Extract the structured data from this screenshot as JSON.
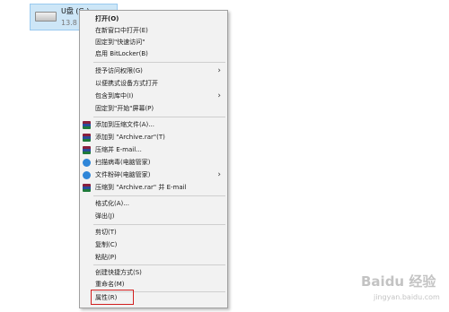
{
  "drive": {
    "name": "U盘 (G:)",
    "size": "13.8",
    "icon": "usb-drive-icon"
  },
  "menu": {
    "items": [
      {
        "label": "打开(O)",
        "bold": true
      },
      {
        "label": "在新窗口中打开(E)"
      },
      {
        "label": "固定到\"快速访问\""
      },
      {
        "label": "启用 BitLocker(B)"
      },
      {
        "label": "授予访问权限(G)",
        "submenu": true
      },
      {
        "label": "以便携式设备方式打开"
      },
      {
        "label": "包含到库中(I)",
        "submenu": true
      },
      {
        "label": "固定到\"开始\"屏幕(P)"
      },
      {
        "label": "添加到压缩文件(A)...",
        "icon": "winrar-icon"
      },
      {
        "label": "添加到 \"Archive.rar\"(T)",
        "icon": "winrar-icon"
      },
      {
        "label": "压缩并 E-mail...",
        "icon": "winrar-icon"
      },
      {
        "label": "扫描病毒(电脑管家)",
        "icon": "shield-icon"
      },
      {
        "label": "文件粉碎(电脑管家)",
        "icon": "shield-icon",
        "submenu": true
      },
      {
        "label": "压缩到 \"Archive.rar\" 并 E-mail",
        "icon": "winrar-icon"
      },
      {
        "label": "格式化(A)..."
      },
      {
        "label": "弹出(J)"
      },
      {
        "label": "剪切(T)"
      },
      {
        "label": "复制(C)"
      },
      {
        "label": "粘贴(P)"
      },
      {
        "label": "创建快捷方式(S)"
      },
      {
        "label": "重命名(M)"
      },
      {
        "label": "属性(R)",
        "highlighted": true
      }
    ],
    "submenu_arrow": "›"
  },
  "annotation": {
    "highlight_color": "#d11f1f"
  },
  "watermark": {
    "text": "Baidu 经验",
    "sub": "jingyan.baidu.com"
  }
}
